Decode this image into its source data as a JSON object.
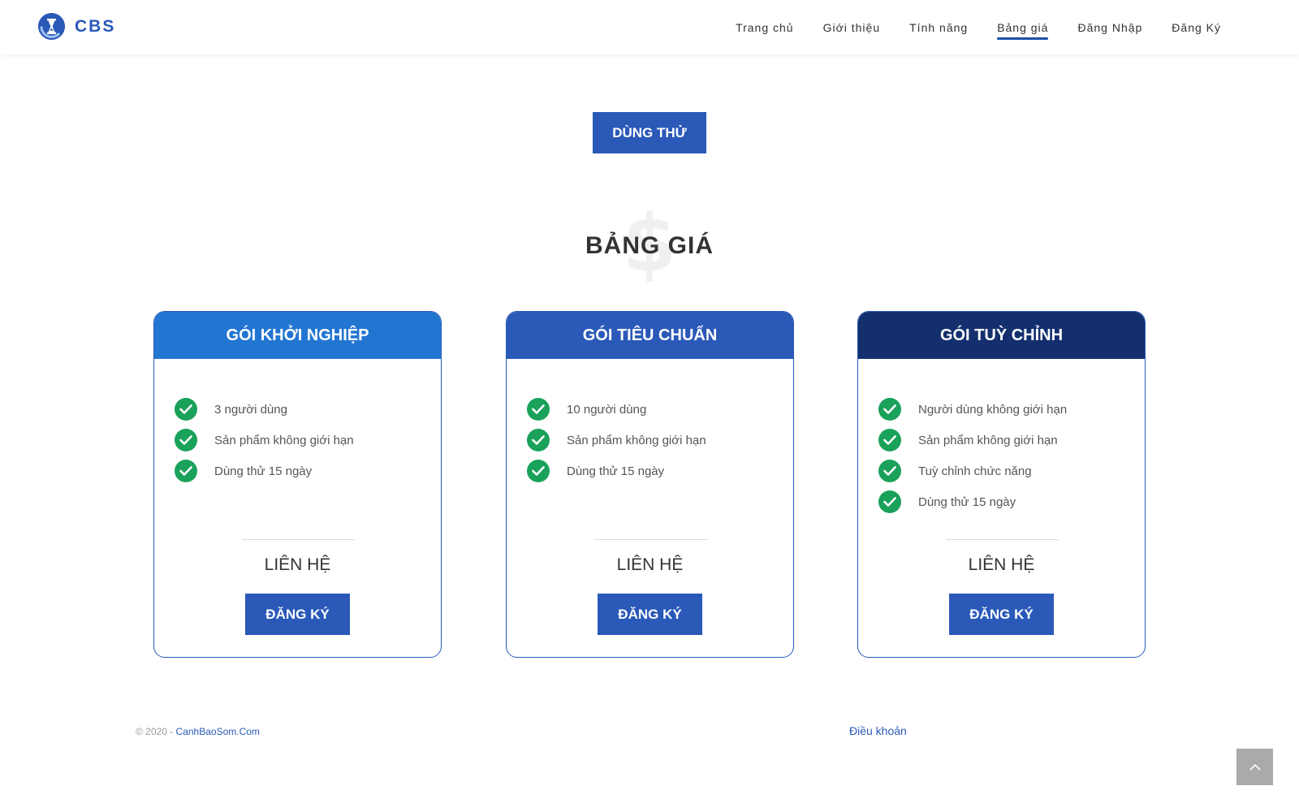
{
  "header": {
    "logo_text": "CBS",
    "nav": [
      {
        "label": "Trang chủ"
      },
      {
        "label": "Giới thiệu"
      },
      {
        "label": "Tính năng"
      },
      {
        "label": "Bảng giá",
        "active": true
      },
      {
        "label": "Đăng Nhập"
      },
      {
        "label": "Đăng Ký"
      }
    ]
  },
  "try_button": "DÙNG THỬ",
  "pricing": {
    "title": "BẢNG GIÁ",
    "background_icon": "dollar-icon",
    "plans": [
      {
        "name": "GÓI KHỞI NGHIỆP",
        "header_color": "#2276d2",
        "features": [
          "3 người dùng",
          "Sản phẩm không giới hạn",
          "Dùng thử 15 ngày"
        ],
        "price": "LIÊN HỆ",
        "button": "ĐĂNG KÝ"
      },
      {
        "name": "GÓI TIÊU CHUẨN",
        "header_color": "#2a59b8",
        "features": [
          "10 người dùng",
          "Sản phẩm không giới hạn",
          "Dùng thử 15 ngày"
        ],
        "price": "LIÊN HỆ",
        "button": "ĐĂNG KÝ"
      },
      {
        "name": "GÓI TUỲ CHỈNH",
        "header_color": "#132f6e",
        "features": [
          "Người dùng không giới hạn",
          "Sản phẩm không giới hạn",
          "Tuỳ chỉnh chức năng",
          "Dùng thử 15 ngày"
        ],
        "price": "LIÊN HỆ",
        "button": "ĐĂNG KÝ"
      }
    ]
  },
  "footer": {
    "copyright_prefix": "© 2020 - ",
    "copyright_link": "CanhBaoSom.Com",
    "terms": "Điều khoản"
  },
  "colors": {
    "brand": "#2a59b8",
    "check": "#1aa15a",
    "back_to_top": "#aaaaaa"
  }
}
